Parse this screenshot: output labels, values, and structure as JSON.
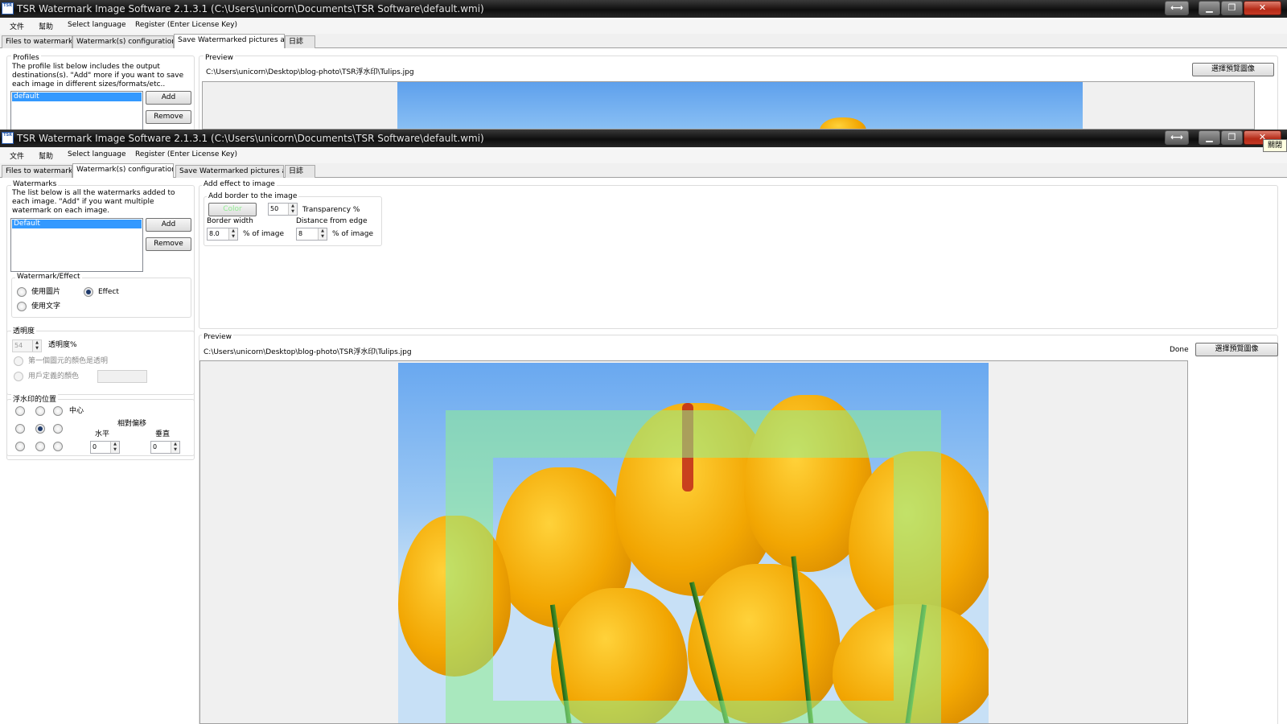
{
  "window_title": "TSR Watermark Image Software 2.1.3.1 (C:\\Users\\unicorn\\Documents\\TSR Software\\default.wmi)",
  "app_icon_text": "TSR",
  "window_buttons": {
    "resize": "⟷",
    "minimize": "▁",
    "maximize": "❐",
    "close": "✕"
  },
  "close_tooltip": "關閉",
  "menu": [
    "文件",
    "幫助",
    "Select language",
    "Register (Enter License Key)"
  ],
  "tabs": [
    "Files to watermark",
    "Watermark(s) configuration",
    "Save Watermarked pictures as",
    "日誌"
  ],
  "save_tab": {
    "profiles_title": "Profiles",
    "profiles_desc": "The profile list below includes the output destinations(s). \"Add\" more if you want to save each image in different sizes/formats/etc..",
    "profiles_items": [
      "default"
    ],
    "add_label": "Add",
    "remove_label": "Remove",
    "preview_title": "Preview",
    "preview_path": "C:\\Users\\unicorn\\Desktop\\blog-photo\\TSR浮水印\\Tulips.jpg",
    "select_preview_label": "選擇預覽圖像"
  },
  "config_tab": {
    "watermarks_title": "Watermarks",
    "watermarks_desc": "The list below is all the watermarks added to each image. \"Add\" if you want multiple watermark on each image.",
    "watermarks_items": [
      "Default"
    ],
    "add_label": "Add",
    "remove_label": "Remove",
    "wm_effect_title": "Watermark/Effect",
    "opt_image": "使用圖片",
    "opt_effect": "Effect",
    "opt_text": "使用文字",
    "selected_option": "Effect",
    "transparency_title": "透明度",
    "transparency_value": "54",
    "transparency_label": "透明度%",
    "first_pixel_label": "第一個圖元的顏色是透明",
    "user_color_label": "用戶定義的顏色",
    "position_title": "浮水印的位置",
    "center_label": "中心",
    "relative_offset_label": "相對偏移",
    "horizontal_label": "水平",
    "vertical_label": "垂直",
    "horizontal_value": "0",
    "vertical_value": "0",
    "selected_position": "middle-center",
    "effect_title": "Add effect to image",
    "border_title": "Add border to the image",
    "color_label": "Color",
    "border_color": "#90ee90",
    "border_transparency_value": "50",
    "border_transparency_label": "Transparency %",
    "border_width_label": "Border width",
    "border_width_value": "8.0",
    "pct_of_image_1": "% of image",
    "distance_label": "Distance from edge",
    "distance_value": "8",
    "pct_of_image_2": "% of image",
    "preview_title": "Preview",
    "preview_path": "C:\\Users\\unicorn\\Desktop\\blog-photo\\TSR浮水印\\Tulips.jpg",
    "done_label": "Done",
    "select_preview_label": "選擇預覽圖像"
  }
}
